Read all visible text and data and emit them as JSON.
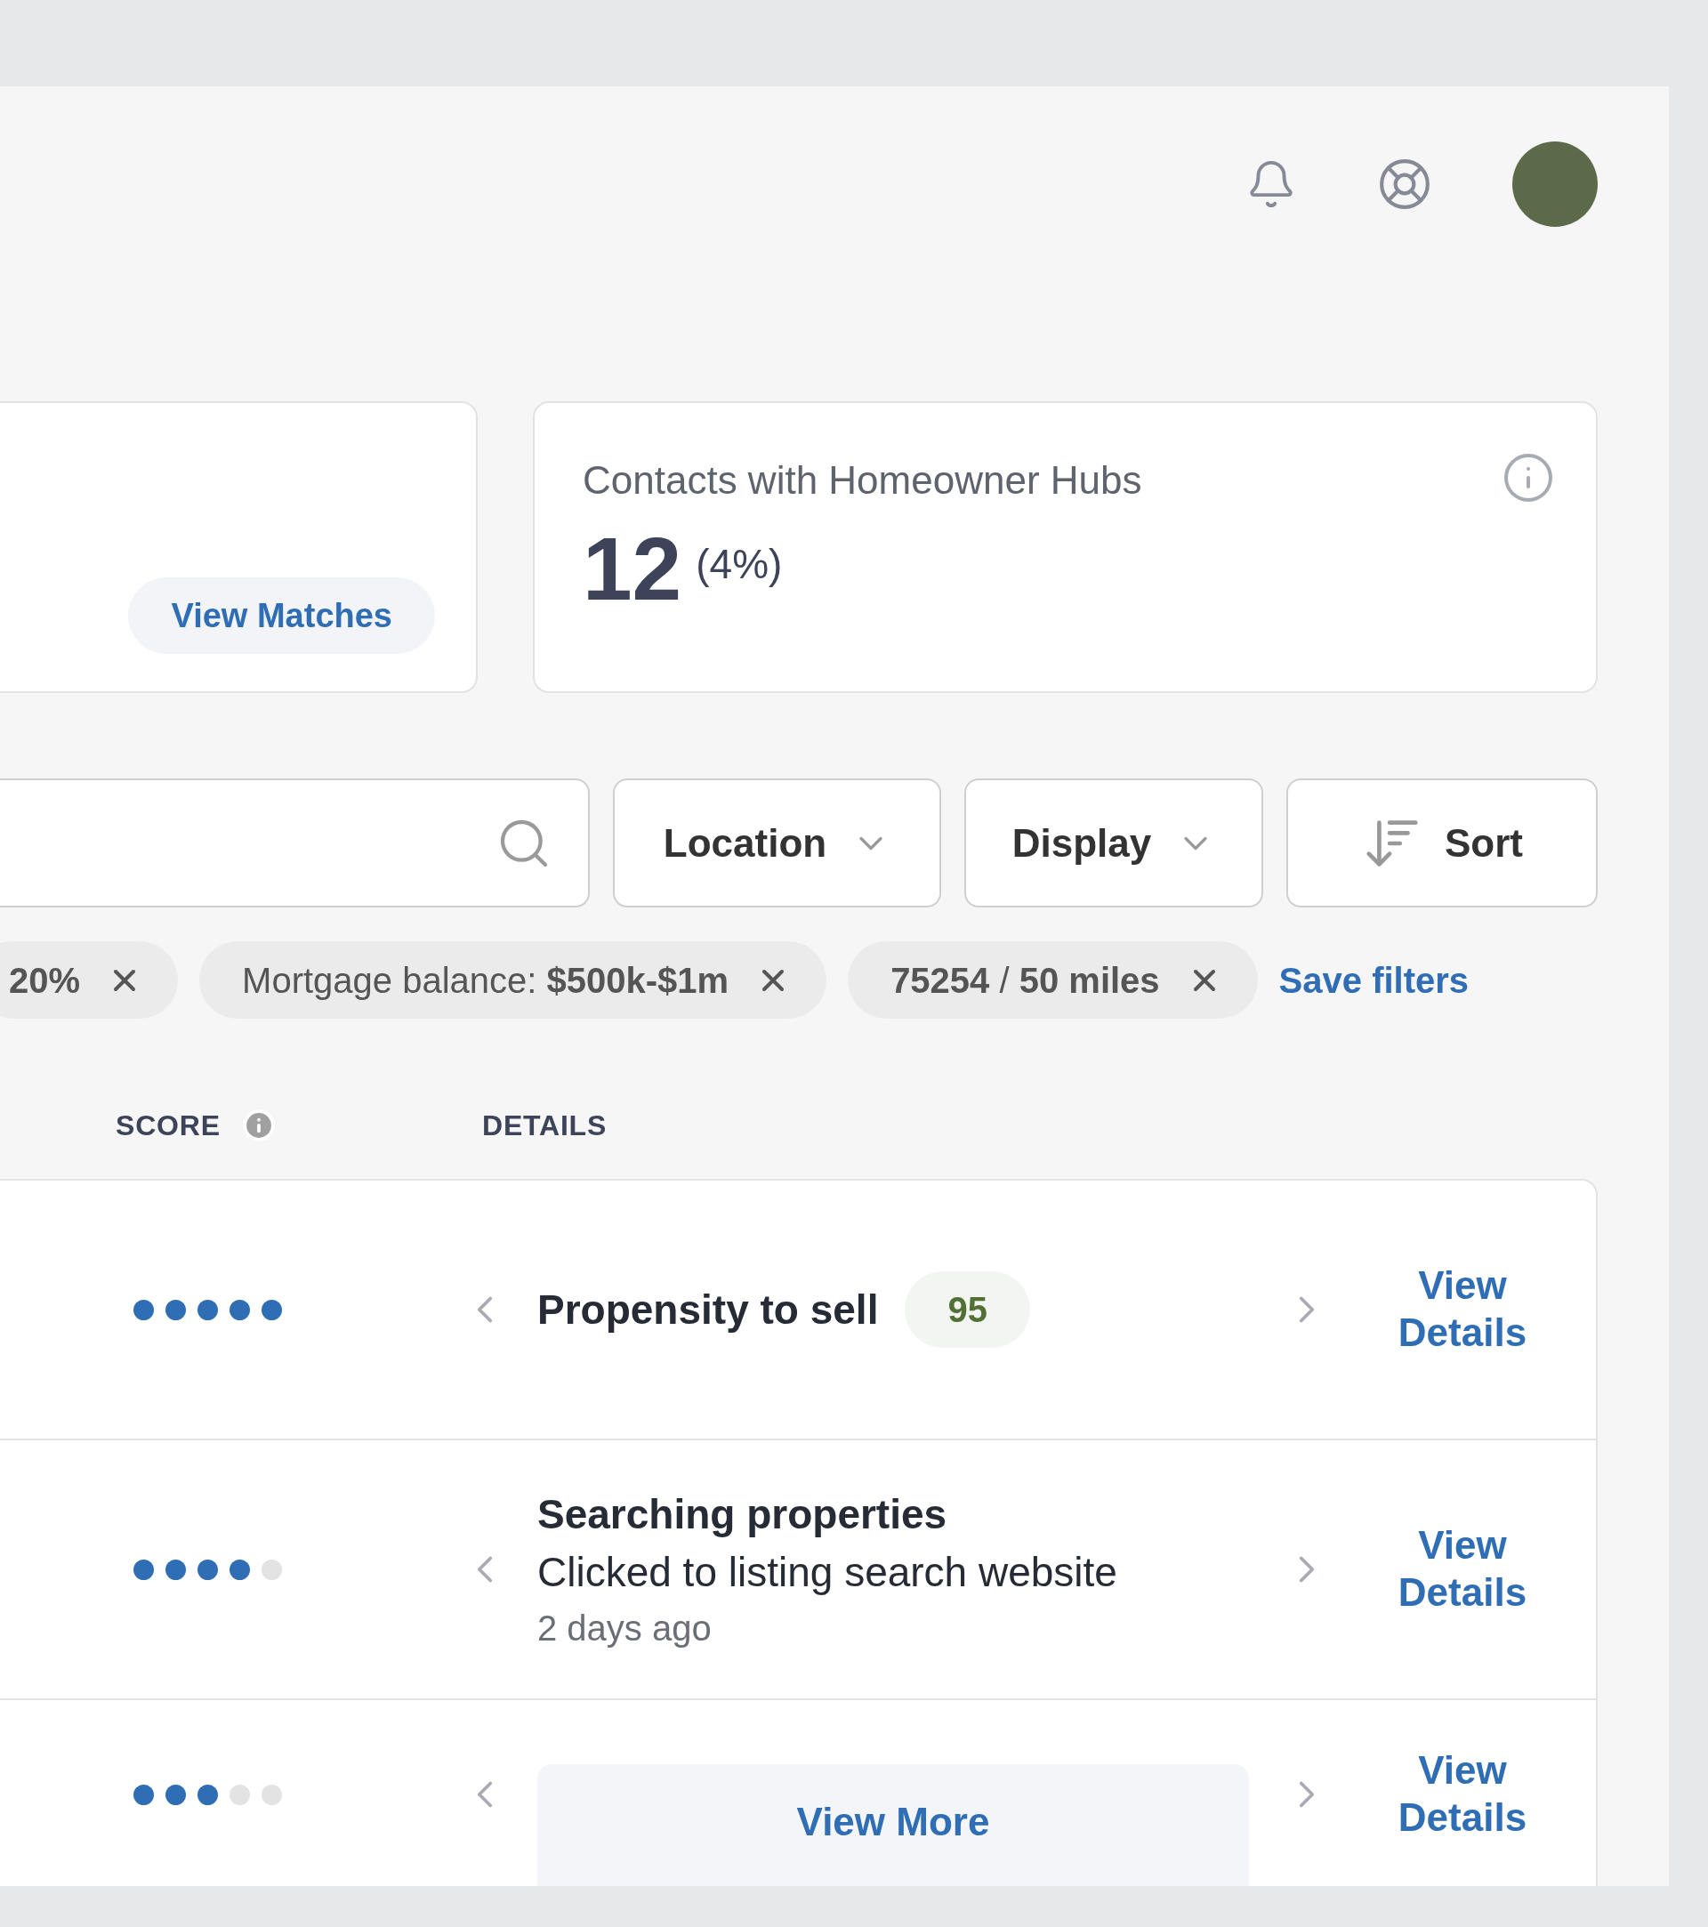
{
  "cards": [
    {
      "kind": "matches",
      "button": "View Matches"
    },
    {
      "kind": "stat",
      "title": "Contacts with Homeowner Hubs",
      "value": "12",
      "percent": "(4%)"
    }
  ],
  "filters": [
    {
      "kind": "search"
    },
    {
      "kind": "dropdown",
      "label": "Location"
    },
    {
      "kind": "dropdown",
      "label": "Display"
    },
    {
      "kind": "sort",
      "label": "Sort"
    }
  ],
  "chips": [
    {
      "text": "**20%**"
    },
    {
      "text": "Mortgage balance: **$500k-$1m**"
    },
    {
      "text": "**75254** / **50 miles**"
    }
  ],
  "save_filters": "Save filters",
  "table": {
    "columns": [
      {
        "label": "SCORE",
        "kind": "with_info"
      },
      {
        "label": "DETAILS",
        "kind": "plain"
      }
    ],
    "rows": [
      {
        "kind": "score",
        "stars": 5,
        "title": "Propensity to sell",
        "badge": "95",
        "action": "View Details"
      },
      {
        "kind": "activity",
        "stars": 4,
        "title": "Searching properties",
        "description": "Clicked to listing search website",
        "time": "2 days ago",
        "action": "View Details"
      },
      {
        "kind": "more",
        "stars": 3,
        "button": "View More",
        "action": "View Details"
      }
    ]
  }
}
